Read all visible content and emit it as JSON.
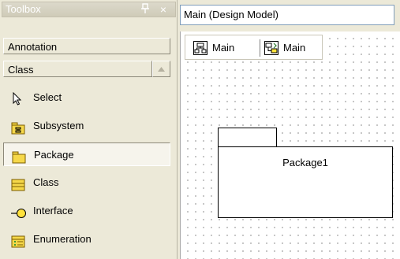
{
  "toolbox": {
    "title": "Toolbox",
    "pin_glyph": "▐",
    "close_glyph": "×",
    "categories": [
      "Annotation",
      "Class"
    ],
    "tools": [
      {
        "label": "Select",
        "icon": "pointer-icon"
      },
      {
        "label": "Subsystem",
        "icon": "subsystem-icon"
      },
      {
        "label": "Package",
        "icon": "package-icon",
        "selected": true
      },
      {
        "label": "Class",
        "icon": "class-icon"
      },
      {
        "label": "Interface",
        "icon": "interface-icon"
      },
      {
        "label": "Enumeration",
        "icon": "enumeration-icon"
      }
    ]
  },
  "document": {
    "title": "Main (Design Model)",
    "tabs": [
      {
        "label": "Main",
        "icon": "diagram-icon"
      },
      {
        "label": "Main",
        "icon": "diagram-link-icon"
      }
    ]
  },
  "canvas": {
    "package_name": "Package1"
  },
  "colors": {
    "panel_bg": "#ece9d8",
    "canvas_bg": "#ffffff",
    "icon_yellow": "#f6d84a",
    "interface_yellow": "#ffe23c"
  }
}
